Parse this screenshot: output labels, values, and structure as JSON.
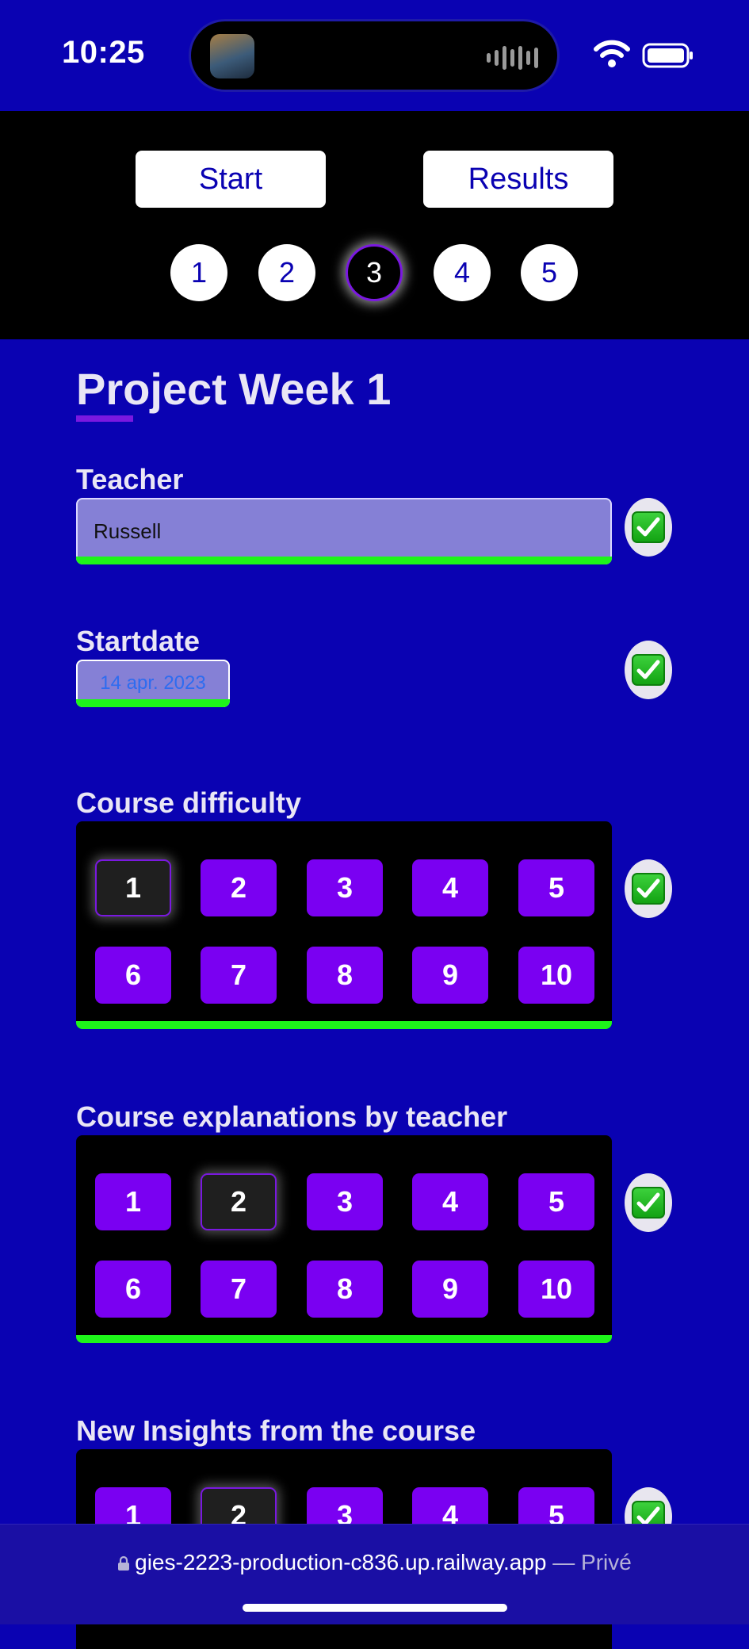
{
  "status_bar": {
    "time": "10:25"
  },
  "nav": {
    "start_label": "Start",
    "results_label": "Results"
  },
  "steps": {
    "items": [
      "1",
      "2",
      "3",
      "4",
      "5"
    ],
    "active": "3"
  },
  "title": "Project Week 1",
  "fields": {
    "teacher": {
      "label": "Teacher",
      "value": "Russell"
    },
    "startdate": {
      "label": "Startdate",
      "value": "14 apr. 2023"
    },
    "course_difficulty": {
      "label": "Course difficulty",
      "options": [
        "1",
        "2",
        "3",
        "4",
        "5",
        "6",
        "7",
        "8",
        "9",
        "10"
      ],
      "selected": "1"
    },
    "course_explanations": {
      "label": "Course explanations by teacher",
      "options": [
        "1",
        "2",
        "3",
        "4",
        "5",
        "6",
        "7",
        "8",
        "9",
        "10"
      ],
      "selected": "2"
    },
    "new_insights": {
      "label": "New Insights from the course",
      "options": [
        "1",
        "2",
        "3",
        "4",
        "5"
      ],
      "selected": "2"
    }
  },
  "browser": {
    "url": "gies-2223-production-c836.up.railway.app",
    "suffix": " — Privé"
  },
  "colors": {
    "background": "#0a02b2",
    "accent": "#7a00f2",
    "valid": "#1ef51a"
  },
  "icons": {
    "check": "check-mark-icon",
    "lock": "lock-icon",
    "wifi": "wifi-icon",
    "battery": "battery-icon"
  }
}
